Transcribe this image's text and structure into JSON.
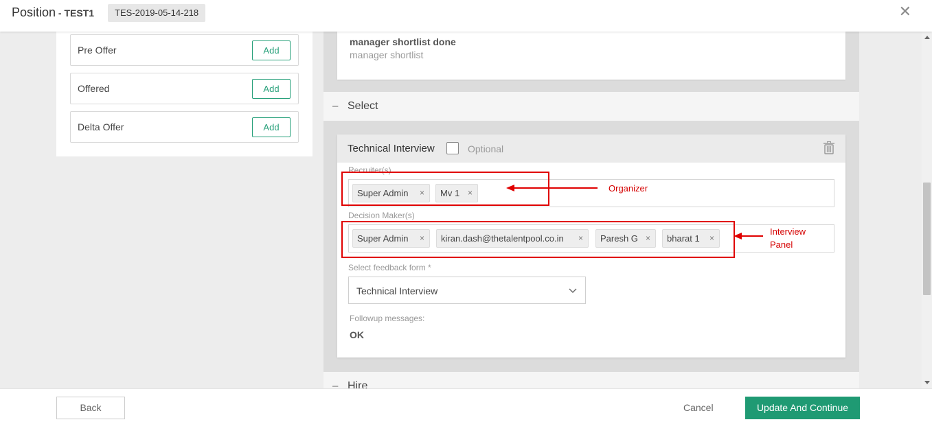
{
  "header": {
    "title": "Position",
    "separator": " - ",
    "subtitle": "TEST1",
    "code": "TES-2019-05-14-218",
    "close_glyph": "✕"
  },
  "stages": [
    {
      "label": "Pre Offer",
      "button": "Add"
    },
    {
      "label": "Offered",
      "button": "Add"
    },
    {
      "label": "Delta Offer",
      "button": "Add"
    }
  ],
  "previous_card": {
    "title": "manager shortlist done",
    "subtitle": "manager shortlist"
  },
  "sections": {
    "select": {
      "toggle": "–",
      "label": "Select"
    },
    "hire": {
      "toggle": "–",
      "label": "Hire"
    }
  },
  "interview": {
    "name": "Technical Interview",
    "optional_label": "Optional",
    "recruiters_label": "Recruiter(s)",
    "recruiters": [
      "Super Admin",
      "Mv 1"
    ],
    "decision_makers_label": "Decision Maker(s)",
    "decision_makers": [
      "Super Admin",
      "kiran.dash@thetalentpool.co.in",
      "Paresh G",
      "bharat 1"
    ],
    "feedback_label": "Select feedback form *",
    "feedback_value": "Technical Interview",
    "followup_label": "Followup messages:",
    "followup_value": "OK",
    "tag_remove_glyph": "×"
  },
  "annotations": {
    "organizer": "Organizer",
    "panel_line1": "Interview",
    "panel_line2": "Panel"
  },
  "footer": {
    "back": "Back",
    "cancel": "Cancel",
    "update": "Update And Continue"
  },
  "colors": {
    "accent": "#1f9a73",
    "annotation": "#e00000"
  }
}
